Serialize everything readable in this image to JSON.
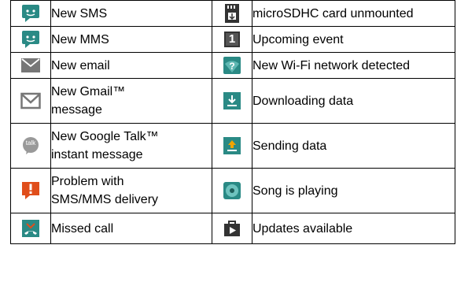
{
  "colors": {
    "teal": "#2a8a85",
    "gray": "#777777",
    "orange": "#e04e1b",
    "dark": "#333333",
    "teal_light": "#5fb8b3"
  },
  "rows": [
    {
      "left": {
        "icon": "sms-icon",
        "lines": [
          "New SMS"
        ]
      },
      "right": {
        "icon": "sd-card-icon",
        "lines": [
          "microSDHC card unmounted"
        ]
      }
    },
    {
      "left": {
        "icon": "mms-icon",
        "lines": [
          "New MMS"
        ]
      },
      "right": {
        "icon": "calendar-icon",
        "lines": [
          "Upcoming event"
        ]
      }
    },
    {
      "left": {
        "icon": "email-icon",
        "lines": [
          "New email"
        ]
      },
      "right": {
        "icon": "wifi-question-icon",
        "lines": [
          "New Wi-Fi network detected"
        ]
      }
    },
    {
      "left": {
        "icon": "gmail-icon",
        "lines": [
          "New Gmail™",
          "message"
        ]
      },
      "right": {
        "icon": "download-icon",
        "lines": [
          "Downloading data"
        ]
      }
    },
    {
      "left": {
        "icon": "google-talk-icon",
        "icon_text": "talk",
        "lines": [
          "New Google Talk™",
          "instant message"
        ]
      },
      "right": {
        "icon": "upload-icon",
        "lines": [
          "Sending data"
        ]
      }
    },
    {
      "left": {
        "icon": "warning-icon",
        "lines": [
          "Problem with",
          "SMS/MMS delivery"
        ]
      },
      "right": {
        "icon": "music-disc-icon",
        "lines": [
          "Song is playing"
        ]
      }
    },
    {
      "left": {
        "icon": "missed-call-icon",
        "lines": [
          "Missed call"
        ]
      },
      "right": {
        "icon": "play-store-icon",
        "lines": [
          "Updates available"
        ]
      }
    }
  ],
  "calendar_day": "1"
}
